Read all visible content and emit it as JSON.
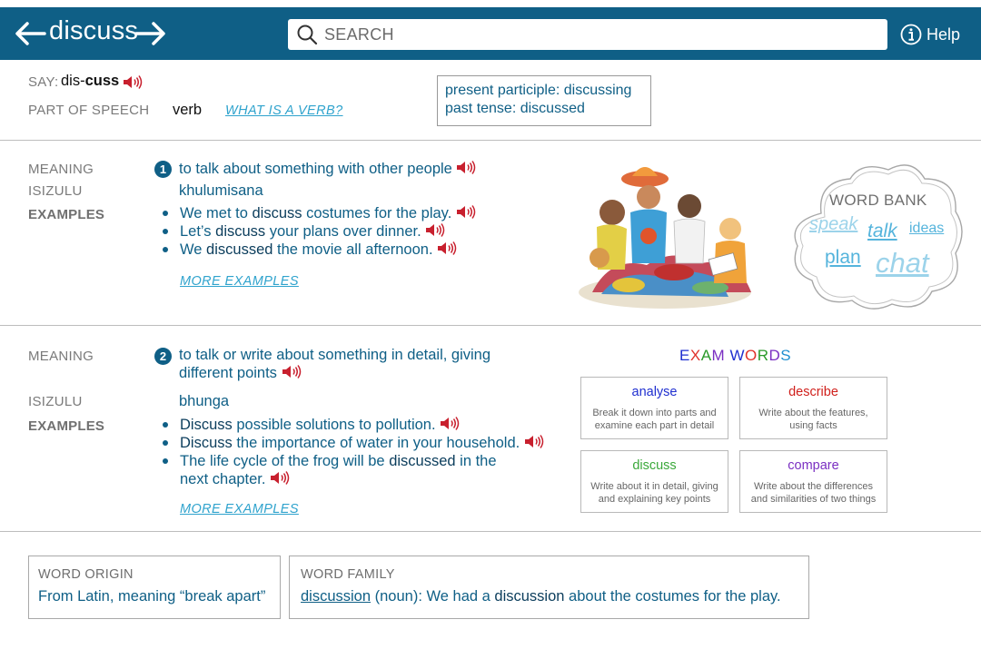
{
  "header": {
    "title": "discuss",
    "back_icon": "left-arrow-icon",
    "forward_icon": "right-arrow-icon",
    "search_placeholder": "SEARCH",
    "help_label": "Help",
    "bar_color": "#0f5f86"
  },
  "pronunciation": {
    "label": "SAY:",
    "syllable_1": "dis-",
    "syllable_2": "cuss",
    "speaker_icon": "speaker-icon"
  },
  "part_of_speech": {
    "label": "PART OF SPEECH",
    "value": "verb",
    "help_link": "WHAT IS A VERB?"
  },
  "forms": {
    "present_participle": "present participle: discussing",
    "past_tense": "past tense: discussed"
  },
  "meanings": [
    {
      "number": "1",
      "meaning_label": "MEANING",
      "definition": "to talk about something with other people",
      "isizulu_label": "ISIZULU",
      "isizulu": "khulumisana",
      "examples_label": "EXAMPLES",
      "examples": [
        {
          "pre": "We met to ",
          "word": "discuss",
          "post": " costumes for the play."
        },
        {
          "pre": "Let’s ",
          "word": "discuss",
          "post": " your plans over dinner."
        },
        {
          "pre": "We ",
          "word": "discussed",
          "post": " the movie all afternoon."
        }
      ],
      "more_link": "MORE EXAMPLES"
    },
    {
      "number": "2",
      "meaning_label": "MEANING",
      "definition_line1": "to talk or write about something in detail, giving",
      "definition_line2": "different points",
      "isizulu_label": "ISIZULU",
      "isizulu": "bhunga",
      "examples_label": "EXAMPLES",
      "examples": [
        {
          "pre": "",
          "word": "Discuss",
          "post": " possible solutions to pollution."
        },
        {
          "pre": "",
          "word": "Discuss",
          "post": " the importance of water in your household."
        },
        {
          "pre": "The life cycle of the frog will be ",
          "word": "discussed",
          "post": " in the",
          "line2": "next chapter."
        }
      ],
      "more_link": "MORE EXAMPLES"
    }
  ],
  "word_bank": {
    "title": "WORD BANK",
    "words": [
      "speak",
      "talk",
      "ideas",
      "plan",
      "chat"
    ]
  },
  "exam_words": {
    "title_letters": [
      {
        "ch": "E",
        "color": "#1f2fd0"
      },
      {
        "ch": "X",
        "color": "#e0322b"
      },
      {
        "ch": "A",
        "color": "#2a9a2a"
      },
      {
        "ch": "M",
        "color": "#7a2fc2"
      },
      {
        "ch": " ",
        "color": "#000000"
      },
      {
        "ch": "W",
        "color": "#1f2fd0"
      },
      {
        "ch": "O",
        "color": "#e0322b"
      },
      {
        "ch": "R",
        "color": "#2a9a2a"
      },
      {
        "ch": "D",
        "color": "#7a2fc2"
      },
      {
        "ch": "S",
        "color": "#1f8fd0"
      }
    ],
    "cards": [
      {
        "word": "analyse",
        "color": "#1f2fd0",
        "desc_line1": "Break it down into parts and",
        "desc_line2": "examine each part in detail"
      },
      {
        "word": "describe",
        "color": "#d0201c",
        "desc_line1": "Write about the features,",
        "desc_line2": "using facts"
      },
      {
        "word": "discuss",
        "color": "#3aa83a",
        "desc_line1": "Write about it in detail, giving",
        "desc_line2": "and explaining key points"
      },
      {
        "word": "compare",
        "color": "#7a2fc2",
        "desc_line1": "Write about the differences",
        "desc_line2": "and similarities of two things"
      }
    ]
  },
  "word_origin": {
    "label": "WORD ORIGIN",
    "text": "From Latin, meaning “break apart”"
  },
  "word_family": {
    "label": "WORD FAMILY",
    "link": "discussion",
    "text_1": " (noun): We had a ",
    "bold": "discussion",
    "text_2": " about the costumes for the play."
  }
}
